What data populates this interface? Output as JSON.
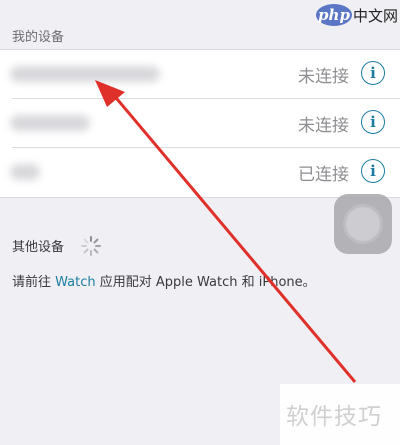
{
  "watermark_top": {
    "badge": "php",
    "text": "中文网"
  },
  "my_devices": {
    "header": "我的设备",
    "devices": [
      {
        "status": "未连接",
        "info_icon": "info-icon"
      },
      {
        "status": "未连接",
        "info_icon": "info-icon"
      },
      {
        "status": "已连接",
        "info_icon": "info-icon"
      }
    ]
  },
  "other_devices": {
    "header": "其他设备",
    "spinner_icon": "loading-spinner-icon"
  },
  "pair_hint": {
    "prefix": "请前往 ",
    "link": "Watch",
    "suffix": " 应用配对 Apple Watch 和 iPhone。"
  },
  "watermark_bottom": {
    "text": "软件技巧"
  },
  "colors": {
    "background": "#efeff4",
    "accent": "#1d7da1",
    "arrow": "#e0302a",
    "status_text": "#8e8e93"
  }
}
